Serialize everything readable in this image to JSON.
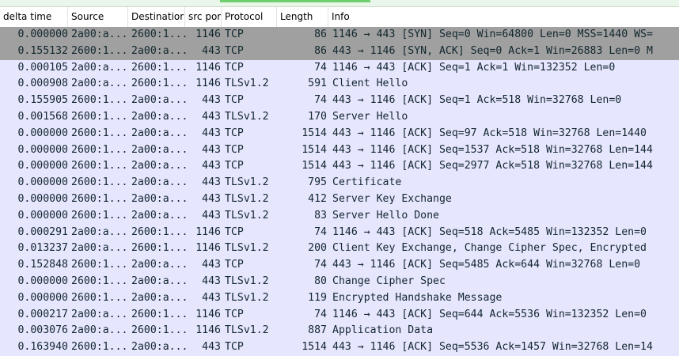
{
  "columns": [
    {
      "key": "time",
      "label": "delta time"
    },
    {
      "key": "src",
      "label": "Source"
    },
    {
      "key": "dst",
      "label": "Destinatior"
    },
    {
      "key": "sport",
      "label": "src por"
    },
    {
      "key": "proto",
      "label": "Protocol"
    },
    {
      "key": "len",
      "label": "Length"
    },
    {
      "key": "info",
      "label": "Info"
    }
  ],
  "colors": {
    "syn_row": "#a0a0a0",
    "normal_row": "#e7e6ff",
    "text": "#12272e"
  },
  "packets": [
    {
      "time": "0.000000",
      "src": "2a00:a...",
      "dst": "2600:1...",
      "sport": "1146",
      "proto": "TCP",
      "len": "86",
      "info": "1146 → 443 [SYN] Seq=0 Win=64800 Len=0 MSS=1440 WS=",
      "style": "syn"
    },
    {
      "time": "0.155132",
      "src": "2600:1...",
      "dst": "2a00:a...",
      "sport": "443",
      "proto": "TCP",
      "len": "86",
      "info": "443 → 1146 [SYN, ACK] Seq=0 Ack=1 Win=26883 Len=0 M",
      "style": "syn"
    },
    {
      "time": "0.000105",
      "src": "2a00:a...",
      "dst": "2600:1...",
      "sport": "1146",
      "proto": "TCP",
      "len": "74",
      "info": "1146 → 443 [ACK] Seq=1 Ack=1 Win=132352 Len=0",
      "style": "tcp"
    },
    {
      "time": "0.000908",
      "src": "2a00:a...",
      "dst": "2600:1...",
      "sport": "1146",
      "proto": "TLSv1.2",
      "len": "591",
      "info": "Client Hello",
      "style": "tls"
    },
    {
      "time": "0.155905",
      "src": "2600:1...",
      "dst": "2a00:a...",
      "sport": "443",
      "proto": "TCP",
      "len": "74",
      "info": "443 → 1146 [ACK] Seq=1 Ack=518 Win=32768 Len=0",
      "style": "tcp"
    },
    {
      "time": "0.001568",
      "src": "2600:1...",
      "dst": "2a00:a...",
      "sport": "443",
      "proto": "TLSv1.2",
      "len": "170",
      "info": "Server Hello",
      "style": "tls"
    },
    {
      "time": "0.000000",
      "src": "2600:1...",
      "dst": "2a00:a...",
      "sport": "443",
      "proto": "TCP",
      "len": "1514",
      "info": "443 → 1146 [ACK] Seq=97 Ack=518 Win=32768 Len=1440",
      "style": "tcp"
    },
    {
      "time": "0.000000",
      "src": "2600:1...",
      "dst": "2a00:a...",
      "sport": "443",
      "proto": "TCP",
      "len": "1514",
      "info": "443 → 1146 [ACK] Seq=1537 Ack=518 Win=32768 Len=144",
      "style": "tcp"
    },
    {
      "time": "0.000000",
      "src": "2600:1...",
      "dst": "2a00:a...",
      "sport": "443",
      "proto": "TCP",
      "len": "1514",
      "info": "443 → 1146 [ACK] Seq=2977 Ack=518 Win=32768 Len=144",
      "style": "tcp"
    },
    {
      "time": "0.000000",
      "src": "2600:1...",
      "dst": "2a00:a...",
      "sport": "443",
      "proto": "TLSv1.2",
      "len": "795",
      "info": "Certificate",
      "style": "tls"
    },
    {
      "time": "0.000000",
      "src": "2600:1...",
      "dst": "2a00:a...",
      "sport": "443",
      "proto": "TLSv1.2",
      "len": "412",
      "info": "Server Key Exchange",
      "style": "tls"
    },
    {
      "time": "0.000000",
      "src": "2600:1...",
      "dst": "2a00:a...",
      "sport": "443",
      "proto": "TLSv1.2",
      "len": "83",
      "info": "Server Hello Done",
      "style": "tls"
    },
    {
      "time": "0.000291",
      "src": "2a00:a...",
      "dst": "2600:1...",
      "sport": "1146",
      "proto": "TCP",
      "len": "74",
      "info": "1146 → 443 [ACK] Seq=518 Ack=5485 Win=132352 Len=0",
      "style": "tcp"
    },
    {
      "time": "0.013237",
      "src": "2a00:a...",
      "dst": "2600:1...",
      "sport": "1146",
      "proto": "TLSv1.2",
      "len": "200",
      "info": "Client Key Exchange, Change Cipher Spec, Encrypted",
      "style": "tls"
    },
    {
      "time": "0.152848",
      "src": "2600:1...",
      "dst": "2a00:a...",
      "sport": "443",
      "proto": "TCP",
      "len": "74",
      "info": "443 → 1146 [ACK] Seq=5485 Ack=644 Win=32768 Len=0",
      "style": "tcp"
    },
    {
      "time": "0.000000",
      "src": "2600:1...",
      "dst": "2a00:a...",
      "sport": "443",
      "proto": "TLSv1.2",
      "len": "80",
      "info": "Change Cipher Spec",
      "style": "tls"
    },
    {
      "time": "0.000000",
      "src": "2600:1...",
      "dst": "2a00:a...",
      "sport": "443",
      "proto": "TLSv1.2",
      "len": "119",
      "info": "Encrypted Handshake Message",
      "style": "tls"
    },
    {
      "time": "0.000217",
      "src": "2a00:a...",
      "dst": "2600:1...",
      "sport": "1146",
      "proto": "TCP",
      "len": "74",
      "info": "1146 → 443 [ACK] Seq=644 Ack=5536 Win=132352 Len=0",
      "style": "tcp"
    },
    {
      "time": "0.003076",
      "src": "2a00:a...",
      "dst": "2600:1...",
      "sport": "1146",
      "proto": "TLSv1.2",
      "len": "887",
      "info": "Application Data",
      "style": "tls"
    },
    {
      "time": "0.163940",
      "src": "2600:1...",
      "dst": "2a00:a...",
      "sport": "443",
      "proto": "TCP",
      "len": "1514",
      "info": "443 → 1146 [ACK] Seq=5536 Ack=1457 Win=32768 Len=14",
      "style": "tcp"
    }
  ]
}
